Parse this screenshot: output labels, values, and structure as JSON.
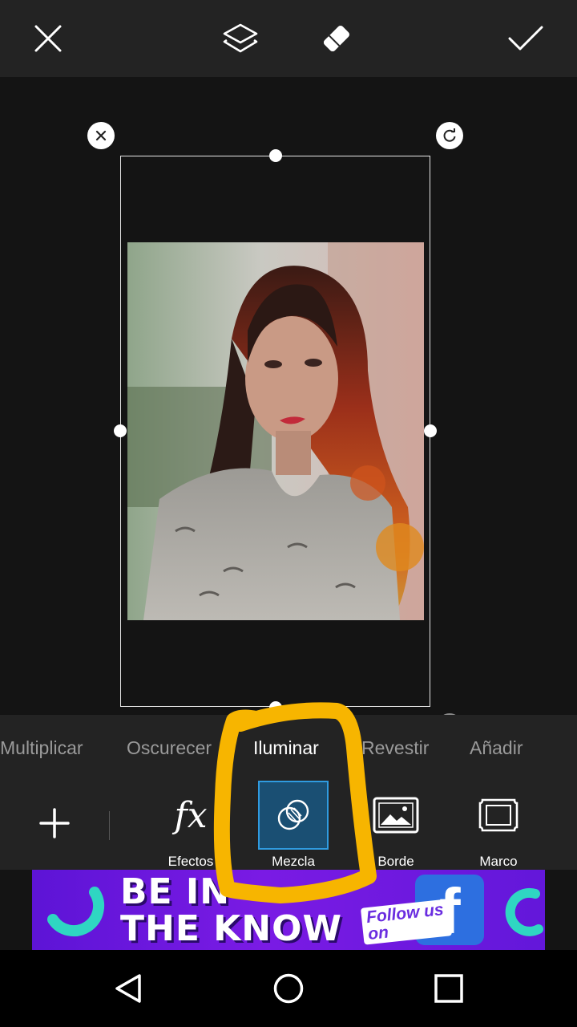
{
  "toolbar": {
    "close_icon": "close-icon",
    "layers_icon": "layers-icon",
    "eraser_icon": "eraser-icon",
    "apply_icon": "check-icon"
  },
  "canvas": {
    "photo_description_icon": "photo-layer"
  },
  "blend_modes": [
    {
      "label": "Multiplicar",
      "active": false
    },
    {
      "label": "Oscurecer",
      "active": false
    },
    {
      "label": "Iluminar",
      "active": true
    },
    {
      "label": "Revestir",
      "active": false
    },
    {
      "label": "Añadir",
      "active": false
    }
  ],
  "tools": [
    {
      "label": "Efectos",
      "icon": "fx-icon",
      "selected": false
    },
    {
      "label": "Mezcla",
      "icon": "blend-icon",
      "selected": true
    },
    {
      "label": "Borde",
      "icon": "border-icon",
      "selected": false
    },
    {
      "label": "Marco",
      "icon": "frame-icon",
      "selected": false
    }
  ],
  "ad": {
    "line1": "BE IN",
    "line2": "THE KNOW",
    "follow": "Follow us on",
    "brand": "f"
  },
  "colors": {
    "accent_blue": "#2f9be0",
    "selected_tool_bg": "#1a4f73",
    "highlight_yellow": "#f7b500",
    "ad_purple": "#6a1be0"
  }
}
